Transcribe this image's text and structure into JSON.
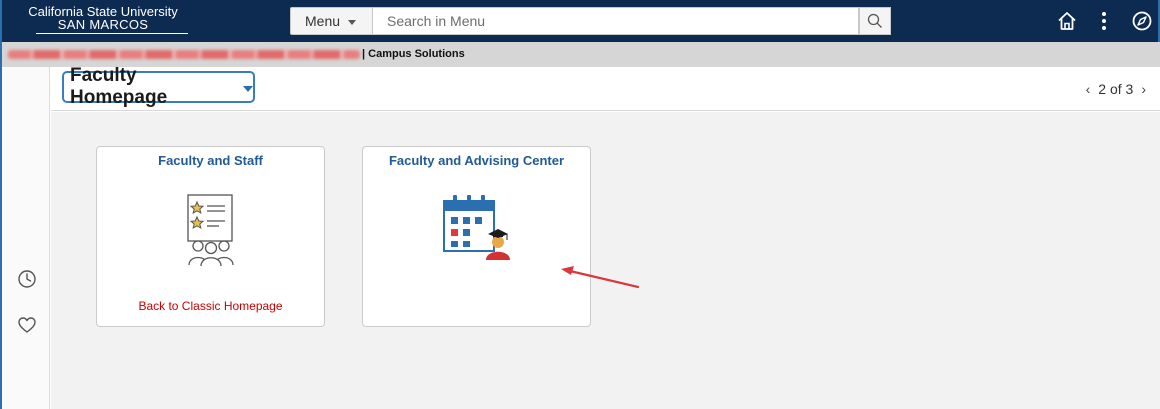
{
  "header": {
    "logo_line1": "California State University",
    "logo_line2": "SAN MARCOS",
    "menu_label": "Menu",
    "search_placeholder": "Search in Menu",
    "icons": [
      "home-icon",
      "more-vertical-icon",
      "compass-icon"
    ]
  },
  "status": {
    "context": "| Campus Solutions"
  },
  "titlebar": {
    "homepage_label": "Faculty Homepage",
    "page_indicator": "2 of 3"
  },
  "left_rail": {
    "icons": [
      "recent-history-icon",
      "favorites-heart-icon"
    ]
  },
  "tiles": [
    {
      "title": "Faculty and Staff",
      "link": "Back to Classic Homepage",
      "icon": "faculty-staff-list-icon"
    },
    {
      "title": "Faculty and Advising Center",
      "link": "",
      "icon": "calendar-graduate-icon"
    }
  ],
  "colors": {
    "header_bg": "#0d2b50",
    "tile_title": "#215a96",
    "link_red": "#cc0000",
    "annotation_arrow": "#d9373a"
  }
}
